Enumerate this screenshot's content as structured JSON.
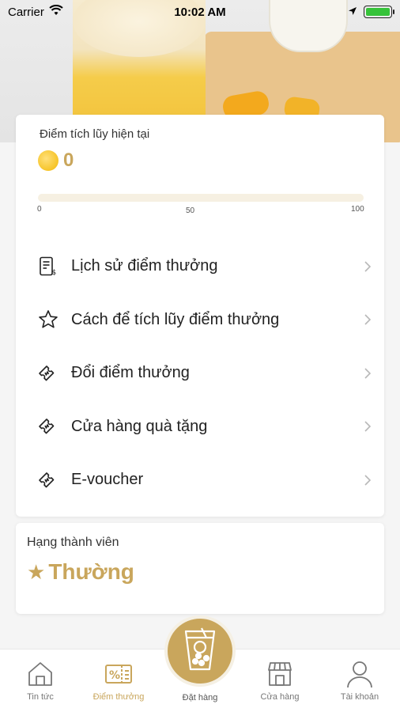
{
  "status_bar": {
    "carrier": "Carrier",
    "time": "10:02 AM"
  },
  "points": {
    "title": "Điểm tích lũy hiện tại",
    "value": "0",
    "progress": 0,
    "ticks": [
      "0",
      "50",
      "100"
    ]
  },
  "menu": [
    {
      "label": "Lịch sử điểm thưởng",
      "icon": "receipt-icon"
    },
    {
      "label": "Cách để tích lũy điểm thưởng",
      "icon": "star-icon"
    },
    {
      "label": "Đổi điểm thưởng",
      "icon": "ticket-icon"
    },
    {
      "label": "Cửa hàng quà tặng",
      "icon": "ticket-icon"
    },
    {
      "label": "E-voucher",
      "icon": "ticket-icon"
    }
  ],
  "rank": {
    "title": "Hạng thành viên",
    "value": "Thường"
  },
  "nav": {
    "news": "Tin tức",
    "rewards": "Điểm thưởng",
    "order": "Đặt hàng",
    "stores": "Cửa hàng",
    "account": "Tài khoản"
  },
  "colors": {
    "accent": "#c9a65c",
    "coin": "#f6c428",
    "battery": "#36c33a"
  }
}
